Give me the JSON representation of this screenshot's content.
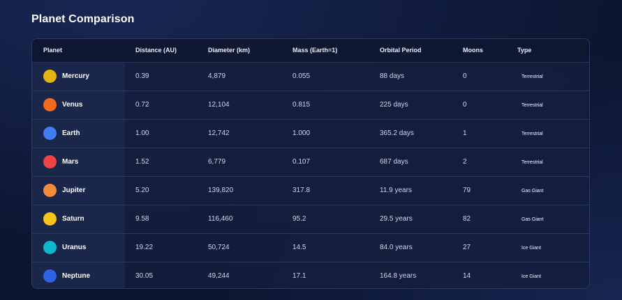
{
  "page": {
    "title": "Planet Comparison"
  },
  "table": {
    "headers": [
      "Planet",
      "Distance (AU)",
      "Diameter (km)",
      "Mass (Earth=1)",
      "Orbital Period",
      "Moons",
      "Type"
    ],
    "rows": [
      {
        "planet": "Mercury",
        "color": "#e6b411",
        "distance": "0.39",
        "diameter": "4,879",
        "mass": "0.055",
        "period": "88 days",
        "moons": "0",
        "type": "Terrestrial"
      },
      {
        "planet": "Venus",
        "color": "#f26a1b",
        "distance": "0.72",
        "diameter": "12,104",
        "mass": "0.815",
        "period": "225 days",
        "moons": "0",
        "type": "Terrestrial"
      },
      {
        "planet": "Earth",
        "color": "#3d7ff2",
        "distance": "1.00",
        "diameter": "12,742",
        "mass": "1.000",
        "period": "365.2 days",
        "moons": "1",
        "type": "Terrestrial"
      },
      {
        "planet": "Mars",
        "color": "#ef4444",
        "distance": "1.52",
        "diameter": "6,779",
        "mass": "0.107",
        "period": "687 days",
        "moons": "2",
        "type": "Terrestrial"
      },
      {
        "planet": "Jupiter",
        "color": "#f28b3a",
        "distance": "5.20",
        "diameter": "139,820",
        "mass": "317.8",
        "period": "11.9 years",
        "moons": "79",
        "type": "Gas Giant"
      },
      {
        "planet": "Saturn",
        "color": "#f6c31a",
        "distance": "9.58",
        "diameter": "116,460",
        "mass": "95.2",
        "period": "29.5 years",
        "moons": "82",
        "type": "Gas Giant"
      },
      {
        "planet": "Uranus",
        "color": "#0fb6cf",
        "distance": "19.22",
        "diameter": "50,724",
        "mass": "14.5",
        "period": "84.0 years",
        "moons": "27",
        "type": "Ice Giant"
      },
      {
        "planet": "Neptune",
        "color": "#2f63e6",
        "distance": "30.05",
        "diameter": "49,244",
        "mass": "17.1",
        "period": "164.8 years",
        "moons": "14",
        "type": "Ice Giant"
      }
    ]
  }
}
